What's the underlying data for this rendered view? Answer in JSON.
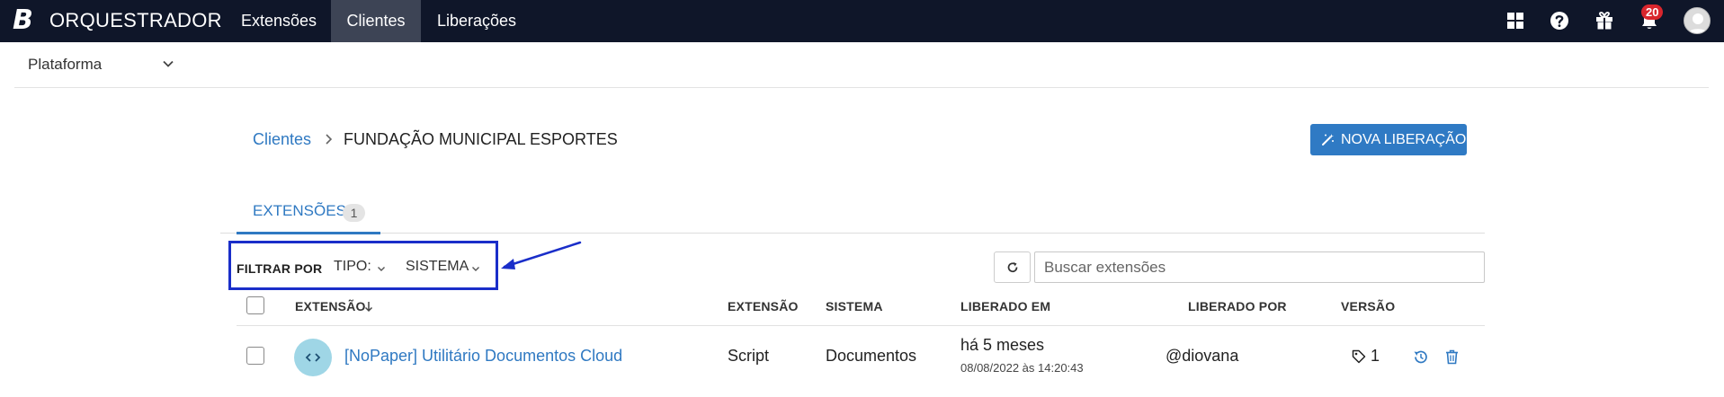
{
  "topnav": {
    "logo": "B",
    "brand": "ORQUESTRADOR",
    "items": [
      {
        "label": "Extensões",
        "active": false
      },
      {
        "label": "Clientes",
        "active": true
      },
      {
        "label": "Liberações",
        "active": false
      }
    ],
    "icons": [
      "grid-icon",
      "help-icon",
      "gift-icon",
      "bell-icon"
    ],
    "notifications_count": "20"
  },
  "secbar": {
    "platform_select": "Plataforma"
  },
  "breadcrumb": {
    "parent": "Clientes",
    "current": "FUNDAÇÃO MUNICIPAL ESPORTES"
  },
  "actions": {
    "new_release": "NOVA LIBERAÇÃO"
  },
  "tabs": [
    {
      "label": "EXTENSÕES",
      "count": "1"
    }
  ],
  "filter": {
    "label": "FILTRAR POR",
    "tipo": "TIPO:",
    "sistema": "SISTEMA"
  },
  "search": {
    "placeholder": "Buscar extensões"
  },
  "table": {
    "headers": {
      "name": "EXTENSÃO",
      "type": "EXTENSÃO",
      "system": "SISTEMA",
      "released_at": "LIBERADO EM",
      "released_by": "LIBERADO POR",
      "version": "VERSÃO"
    },
    "rows": [
      {
        "name": "[NoPaper] Utilitário Documentos Cloud",
        "type": "Script",
        "system": "Documentos",
        "released_relative": "há 5 meses",
        "released_date": "08/08/2022 às 14:20:43",
        "released_by": "@diovana",
        "version": "1"
      }
    ]
  },
  "colors": {
    "nav_bg": "#0f1629",
    "nav_active": "#3d4455",
    "accent": "#2f79c2",
    "badge": "#d9262d",
    "annotation": "#1a2ec9"
  }
}
